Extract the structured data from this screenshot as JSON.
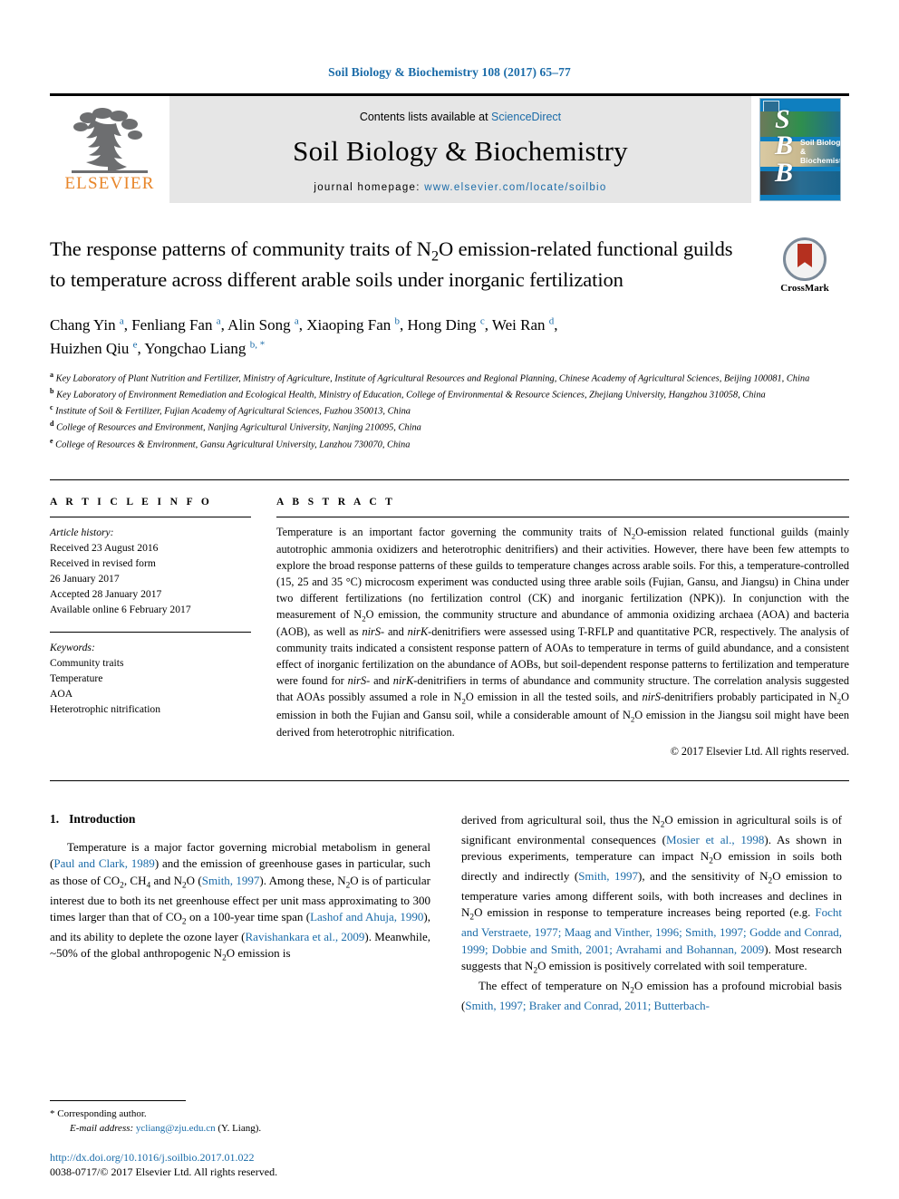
{
  "running_head": "Soil Biology & Biochemistry 108 (2017) 65–77",
  "masthead": {
    "contents_prefix": "Contents lists available at ",
    "contents_link": "ScienceDirect",
    "journal_title": "Soil Biology & Biochemistry",
    "homepage_prefix": "journal homepage: ",
    "homepage_url": "www.elsevier.com/locate/soilbio",
    "publisher_wordmark": "ELSEVIER",
    "cover_initials": "SBB",
    "cover_title": "Soil Biology & Biochemistry"
  },
  "crossmark": {
    "label": "CrossMark"
  },
  "title": "The response patterns of community traits of N2O emission-related functional guilds to temperature across different arable soils under inorganic fertilization",
  "authors": [
    {
      "name": "Chang Yin",
      "marks": "a",
      "sep": ", "
    },
    {
      "name": "Fenliang Fan",
      "marks": "a",
      "sep": ", "
    },
    {
      "name": "Alin Song",
      "marks": "a",
      "sep": ", "
    },
    {
      "name": "Xiaoping Fan",
      "marks": "b",
      "sep": ", "
    },
    {
      "name": "Hong Ding",
      "marks": "c",
      "sep": ", "
    },
    {
      "name": "Wei Ran",
      "marks": "d",
      "sep": ", "
    },
    {
      "name": "Huizhen Qiu",
      "marks": "e",
      "sep": ", "
    },
    {
      "name": "Yongchao Liang",
      "marks": "b, *",
      "sep": ""
    }
  ],
  "affiliations": [
    {
      "mark": "a",
      "text": "Key Laboratory of Plant Nutrition and Fertilizer, Ministry of Agriculture, Institute of Agricultural Resources and Regional Planning, Chinese Academy of Agricultural Sciences, Beijing 100081, China"
    },
    {
      "mark": "b",
      "text": "Key Laboratory of Environment Remediation and Ecological Health, Ministry of Education, College of Environmental & Resource Sciences, Zhejiang University, Hangzhou 310058, China"
    },
    {
      "mark": "c",
      "text": "Institute of Soil & Fertilizer, Fujian Academy of Agricultural Sciences, Fuzhou 350013, China"
    },
    {
      "mark": "d",
      "text": "College of Resources and Environment, Nanjing Agricultural University, Nanjing 210095, China"
    },
    {
      "mark": "e",
      "text": "College of Resources & Environment, Gansu Agricultural University, Lanzhou 730070, China"
    }
  ],
  "article_info": {
    "heading": "A R T I C L E   I N F O",
    "history_label": "Article history:",
    "history": [
      "Received 23 August 2016",
      "Received in revised form",
      "26 January 2017",
      "Accepted 28 January 2017",
      "Available online 6 February 2017"
    ],
    "keywords_label": "Keywords:",
    "keywords": [
      "Community traits",
      "Temperature",
      "AOA",
      "Heterotrophic nitrification"
    ]
  },
  "abstract": {
    "heading": "A B S T R A C T",
    "paragraph_1": "Temperature is an important factor governing the community traits of N2O-emission related functional guilds (mainly autotrophic ammonia oxidizers and heterotrophic denitrifiers) and their activities. However, there have been few attempts to explore the broad response patterns of these guilds to temperature changes across arable soils. For this, a temperature-controlled (15, 25 and 35 °C) microcosm experiment was conducted using three arable soils (Fujian, Gansu, and Jiangsu) in China under two different fertilizations (no fertilization control (CK) and inorganic fertilization (NPK)). In conjunction with the measurement of N2O emission, the community structure and abundance of ammonia oxidizing archaea (AOA) and bacteria (AOB), as well as ",
    "italic_1": "nirS",
    "mid_1": "- and ",
    "italic_2": "nirK",
    "mid_2": "-denitrifiers were assessed using T-RFLP and quantitative PCR, respectively. The analysis of community traits indicated a consistent response pattern of AOAs to temperature in terms of guild abundance, and a consistent effect of inorganic fertilization on the abundance of AOBs, but soil-dependent response patterns to fertilization and temperature were found for ",
    "italic_3": "nirS",
    "mid_3": "- and ",
    "italic_4": "nirK",
    "mid_4": "-denitrifiers in terms of abundance and community structure. The correlation analysis suggested that AOAs possibly assumed a role in N2O emission in all the tested soils, and ",
    "italic_5": "nirS",
    "mid_5": "-denitrifiers probably participated in N2O emission in both the Fujian and Gansu soil, while a considerable amount of N2O emission in the Jiangsu soil might have been derived from heterotrophic nitrification.",
    "copyright": "© 2017 Elsevier Ltd. All rights reserved."
  },
  "introduction": {
    "number": "1.",
    "heading": "Introduction",
    "left_p1_a": "Temperature is a major factor governing microbial metabolism in general (",
    "left_cite1": "Paul and Clark, 1989",
    "left_p1_b": ") and the emission of greenhouse gases in particular, such as those of CO2, CH4 and N2O (",
    "left_cite2": "Smith, 1997",
    "left_p1_c": "). Among these, N2O is of particular interest due to both its net greenhouse effect per unit mass approximating to 300 times larger than that of CO2 on a 100-year time span (",
    "left_cite3": "Lashof and Ahuja, 1990",
    "left_p1_d": "), and its ability to deplete the ozone layer (",
    "left_cite4": "Ravishankara et al., 2009",
    "left_p1_e": "). Meanwhile, ~50% of the global anthropogenic N2O emission is",
    "right_p1_a": "derived from agricultural soil, thus the N2O emission in agricultural soils is of significant environmental consequences (",
    "right_cite1": "Mosier et al., 1998",
    "right_p1_b": "). As shown in previous experiments, temperature can impact N2O emission in soils both directly and indirectly (",
    "right_cite2": "Smith, 1997",
    "right_p1_c": "), and the sensitivity of N2O emission to temperature varies among different soils, with both increases and declines in N2O emission in response to temperature increases being reported (e.g. ",
    "right_cite3": "Focht and Verstraete, 1977; Maag and Vinther, 1996; Smith, 1997; Godde and Conrad, 1999; Dobbie and Smith, 2001; Avrahami and Bohannan, 2009",
    "right_p1_d": "). Most research suggests that N2O emission is positively correlated with soil temperature.",
    "right_p2_a": "The effect of temperature on N2O emission has a profound microbial basis (",
    "right_cite4": "Smith, 1997; Braker and Conrad, 2011; Butterbach-",
    "right_p2_b": ""
  },
  "footer": {
    "corresponding_marker": "*",
    "corresponding_label": "Corresponding author.",
    "email_label": "E-mail address:",
    "email": "ycliang@zju.edu.cn",
    "email_suffix": "(Y. Liang).",
    "doi": "http://dx.doi.org/10.1016/j.soilbio.2017.01.022",
    "issn_line": "0038-0717/© 2017 Elsevier Ltd. All rights reserved."
  },
  "colors": {
    "link": "#1a6ba8",
    "elsevier_orange": "#e8862a",
    "masthead_bg": "#e6e6e6"
  }
}
